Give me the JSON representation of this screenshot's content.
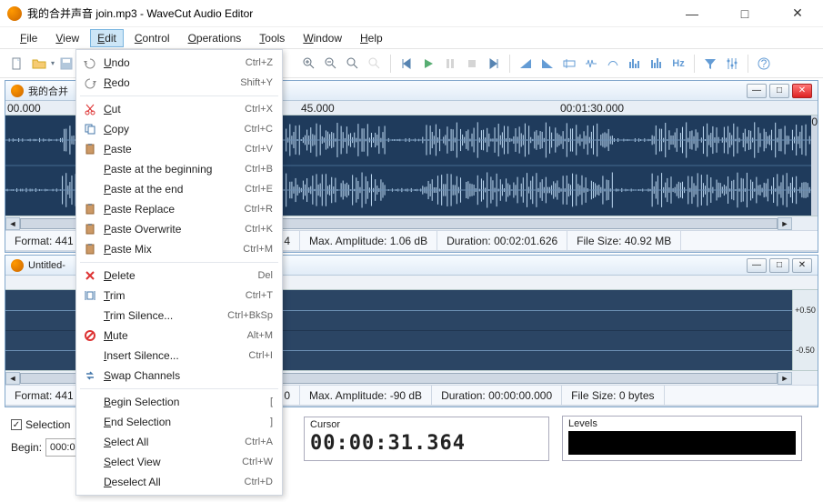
{
  "window": {
    "title": "我的合并声音 join.mp3 - WaveCut Audio Editor"
  },
  "menubar": [
    "File",
    "View",
    "Edit",
    "Control",
    "Operations",
    "Tools",
    "Window",
    "Help"
  ],
  "edit_menu": [
    {
      "icon": "undo",
      "label": "Undo",
      "sc": "Ctrl+Z",
      "disabled": true
    },
    {
      "icon": "redo",
      "label": "Redo",
      "sc": "Shift+Y",
      "disabled": true
    },
    {
      "sep": true
    },
    {
      "icon": "cut",
      "label": "Cut",
      "sc": "Ctrl+X"
    },
    {
      "icon": "copy",
      "label": "Copy",
      "sc": "Ctrl+C"
    },
    {
      "icon": "paste",
      "label": "Paste",
      "sc": "Ctrl+V"
    },
    {
      "icon": "",
      "label": "Paste at the beginning",
      "sc": "Ctrl+B"
    },
    {
      "icon": "",
      "label": "Paste at the end",
      "sc": "Ctrl+E"
    },
    {
      "icon": "paste",
      "label": "Paste Replace",
      "sc": "Ctrl+R"
    },
    {
      "icon": "paste",
      "label": "Paste Overwrite",
      "sc": "Ctrl+K"
    },
    {
      "icon": "paste",
      "label": "Paste Mix",
      "sc": "Ctrl+M"
    },
    {
      "sep": true
    },
    {
      "icon": "delete",
      "label": "Delete",
      "sc": "Del"
    },
    {
      "icon": "trim",
      "label": "Trim",
      "sc": "Ctrl+T"
    },
    {
      "icon": "",
      "label": "Trim Silence...",
      "sc": "Ctrl+BkSp"
    },
    {
      "icon": "mute",
      "label": "Mute",
      "sc": "Alt+M"
    },
    {
      "icon": "",
      "label": "Insert Silence...",
      "sc": "Ctrl+I"
    },
    {
      "icon": "swap",
      "label": "Swap Channels",
      "sc": ""
    },
    {
      "sep": true
    },
    {
      "icon": "",
      "label": "Begin Selection",
      "sc": "["
    },
    {
      "icon": "",
      "label": "End Selection",
      "sc": "]"
    },
    {
      "icon": "",
      "label": "Select All",
      "sc": "Ctrl+A"
    },
    {
      "icon": "",
      "label": "Select View",
      "sc": "Ctrl+W"
    },
    {
      "icon": "",
      "label": "Deselect All",
      "sc": "Ctrl+D"
    }
  ],
  "doc1": {
    "name_prefix": "我的合并",
    "ruler_a": "00.000",
    "ruler_b": "45.000",
    "ruler_c": "00:01:30.000",
    "side": "0",
    "status": {
      "format": "Format: 441",
      "four": "4",
      "maxamp": "Max. Amplitude: 1.06 dB",
      "duration": "Duration: 00:02:01.626",
      "filesize": "File Size: 40.92 MB"
    }
  },
  "doc2": {
    "name": "Untitled-",
    "side_top": "+0.50",
    "side_bot": "-0.50",
    "status": {
      "format": "Format: 441",
      "zero": "0",
      "maxamp": "Max. Amplitude: -90 dB",
      "duration": "Duration: 00:00:00.000",
      "filesize": "File Size: 0 bytes"
    }
  },
  "bottom": {
    "selection": "Selection",
    "begin_label": "Begin:",
    "begin_value": "000:0",
    "cursor_label": "Cursor",
    "cursor_value": "00:00:31.364",
    "levels_label": "Levels"
  }
}
